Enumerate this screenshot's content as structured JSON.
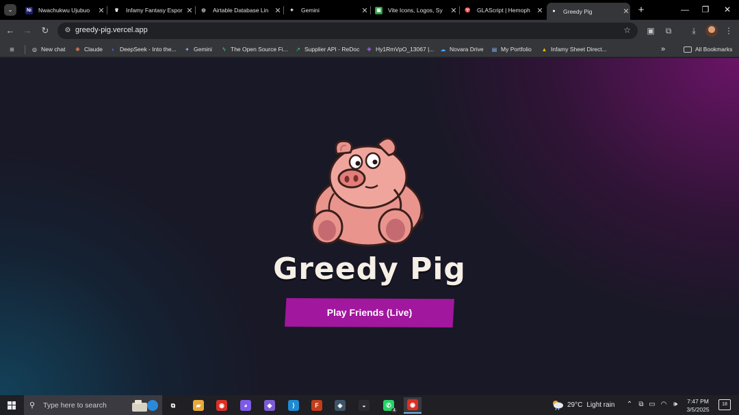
{
  "browser": {
    "tabs": [
      {
        "title": "Nwachukwu Ujubuo",
        "favicon": "notion-icon",
        "fav_text": "Ni",
        "fav_bg": "#1e1e6e",
        "active": false
      },
      {
        "title": "Infamy Fantasy Espor",
        "favicon": "crown-icon",
        "fav_text": "♛",
        "fav_bg": "#000000",
        "active": false
      },
      {
        "title": "Airtable Database Lin",
        "favicon": "openai-icon",
        "fav_text": "◎",
        "fav_bg": "#000000",
        "active": false
      },
      {
        "title": "Gemini",
        "favicon": "gemini-icon",
        "fav_text": "✦",
        "fav_bg": "#000000",
        "active": false
      },
      {
        "title": "Vite Icons, Logos, Sy",
        "favicon": "vite-icon",
        "fav_text": "▣",
        "fav_bg": "#2ea043",
        "active": false
      },
      {
        "title": "GLAScript | Hemoph",
        "favicon": "glascript-icon",
        "fav_text": "♈",
        "fav_bg": "#000000",
        "active": false
      },
      {
        "title": "Greedy Pig",
        "favicon": "brain-icon",
        "fav_text": "●",
        "fav_bg": "#35363a",
        "active": true
      }
    ],
    "url": "greedy-pig.vercel.app",
    "bookmarks": [
      {
        "label": "New chat",
        "icon": "openai-icon",
        "glyph": "◎"
      },
      {
        "label": "Claude",
        "icon": "claude-icon",
        "glyph": "✺"
      },
      {
        "label": "DeepSeek - Into the...",
        "icon": "deepseek-icon",
        "glyph": "◐"
      },
      {
        "label": "Gemini",
        "icon": "gemini-icon",
        "glyph": "✦"
      },
      {
        "label": "The Open Source Fi...",
        "icon": "supabase-icon",
        "glyph": "ϟ"
      },
      {
        "label": "Supplier API - ReDoc",
        "icon": "redoc-icon",
        "glyph": "↗"
      },
      {
        "label": "Hy1RmVpO_13067 |...",
        "icon": "figma-icon",
        "glyph": "✚"
      },
      {
        "label": "Novara Drive",
        "icon": "onedrive-icon",
        "glyph": "☁"
      },
      {
        "label": "My Portfolio",
        "icon": "portfolio-icon",
        "glyph": "▤"
      },
      {
        "label": "Infamy Sheet Direct...",
        "icon": "drive-icon",
        "glyph": "▲"
      }
    ],
    "all_bookmarks": "All Bookmarks"
  },
  "page": {
    "title": "Greedy Pig",
    "play_button": "Play Friends (Live)",
    "colors": {
      "button": "#a1179d",
      "title": "#f5efe6",
      "gradient_purple": "#6e1469",
      "gradient_teal": "#12465f"
    }
  },
  "taskbar": {
    "search_placeholder": "Type here to search",
    "apps": [
      {
        "name": "task-view-icon",
        "glyph": "⧉",
        "bg": "transparent"
      },
      {
        "name": "file-explorer-icon",
        "glyph": "▰",
        "bg": "#e8a93a"
      },
      {
        "name": "chrome-icon",
        "glyph": "◉",
        "bg": "#d93025"
      },
      {
        "name": "discord-icon",
        "glyph": "◕",
        "bg": "#7b5be8"
      },
      {
        "name": "obsidian-icon",
        "glyph": "◆",
        "bg": "#7e5bd6"
      },
      {
        "name": "vscode-icon",
        "glyph": "⟩",
        "bg": "#1f8ad2"
      },
      {
        "name": "figma-icon",
        "glyph": "F",
        "bg": "#c43d1b"
      },
      {
        "name": "davinci-resolve-icon",
        "glyph": "◈",
        "bg": "#3d5566"
      },
      {
        "name": "brave-icon",
        "glyph": "◒",
        "bg": "#2a2a30"
      },
      {
        "name": "whatsapp-icon",
        "glyph": "✆",
        "bg": "#25d366",
        "badge": "4"
      },
      {
        "name": "chrome-profile-icon",
        "glyph": "◉",
        "bg": "#d93025",
        "active": true
      }
    ],
    "weather": {
      "temp": "29°C",
      "condition": "Light rain"
    },
    "time": "7:47 PM",
    "date": "3/5/2025",
    "notification_count": "18"
  }
}
